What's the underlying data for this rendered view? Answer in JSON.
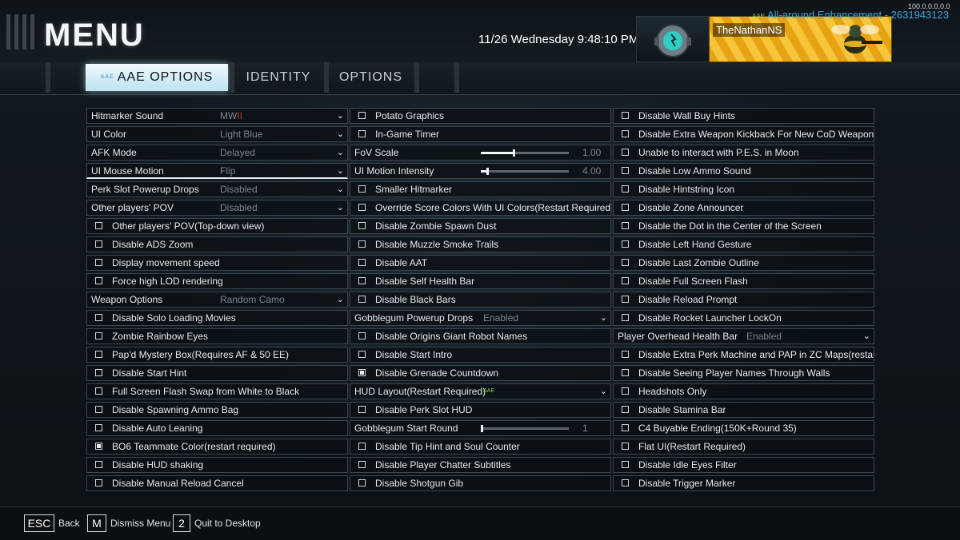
{
  "header": {
    "title": "MENU",
    "datetime": "11/26 Wednesday 9:48:10 PM",
    "version": "100.0.0.0.0.0",
    "mod_tag": "AAE",
    "mod_name": "All-around Enhancement - 2631943123",
    "gamertag": "TheNathanNS"
  },
  "tabs": [
    {
      "label": "AAE OPTIONS",
      "tag": "AAE",
      "active": true
    },
    {
      "label": "IDENTITY",
      "active": false
    },
    {
      "label": "OPTIONS",
      "active": false
    }
  ],
  "columns": [
    {
      "rows": [
        {
          "type": "dropdown",
          "label": "Hitmarker Sound",
          "value": "MW",
          "value_accent": "II"
        },
        {
          "type": "dropdown",
          "label": "UI Color",
          "value": "Light Blue"
        },
        {
          "type": "dropdown",
          "label": "AFK Mode",
          "value": "Delayed"
        },
        {
          "type": "dropdown",
          "label": "UI Mouse Motion",
          "value": "Flip",
          "selected": true
        },
        {
          "type": "dropdown",
          "label": "Perk Slot Powerup Drops",
          "value": "Disabled"
        },
        {
          "type": "dropdown",
          "label": "Other players' POV",
          "value": "Disabled"
        },
        {
          "type": "checkbox",
          "label": "Other players' POV(Top-down view)",
          "checked": false
        },
        {
          "type": "checkbox",
          "label": "Disable ADS Zoom",
          "checked": false
        },
        {
          "type": "checkbox",
          "label": "Display movement speed",
          "checked": false
        },
        {
          "type": "checkbox",
          "label": "Force high LOD rendering",
          "checked": false
        },
        {
          "type": "dropdown",
          "label": "Weapon Options",
          "value": "Random Camo"
        },
        {
          "type": "checkbox",
          "label": "Disable Solo Loading Movies",
          "checked": false
        },
        {
          "type": "checkbox",
          "label": "Zombie Rainbow Eyes",
          "checked": false
        },
        {
          "type": "checkbox",
          "label": "Pap'd Mystery Box(Requires AF & 50 EE)",
          "checked": false
        },
        {
          "type": "checkbox",
          "label": "Disable Start Hint",
          "checked": false
        },
        {
          "type": "checkbox",
          "label": "Full Screen Flash Swap from White to Black",
          "checked": false
        },
        {
          "type": "checkbox",
          "label": "Disable Spawning Ammo Bag",
          "checked": false
        },
        {
          "type": "checkbox",
          "label": "Disable Auto Leaning",
          "checked": false
        },
        {
          "type": "checkbox",
          "label": "BO6 Teammate Color(restart required)",
          "checked": true
        },
        {
          "type": "checkbox",
          "label": "Disable HUD shaking",
          "checked": false
        },
        {
          "type": "checkbox",
          "label": "Disable Manual Reload Cancel",
          "checked": false
        }
      ]
    },
    {
      "rows": [
        {
          "type": "checkbox",
          "label": "Potato Graphics",
          "checked": false
        },
        {
          "type": "checkbox",
          "label": "In-Game Timer",
          "checked": false
        },
        {
          "type": "slider",
          "label": "FoV Scale",
          "value": "1.00",
          "fill": 0.36
        },
        {
          "type": "slider",
          "label": "UI Motion Intensity",
          "value": "4.00",
          "fill": 0.06
        },
        {
          "type": "checkbox",
          "label": "Smaller Hitmarker",
          "checked": false
        },
        {
          "type": "checkbox",
          "label": "Override Score Colors With UI Colors(Restart Required)",
          "checked": false
        },
        {
          "type": "checkbox",
          "label": "Disable Zombie Spawn Dust",
          "checked": false
        },
        {
          "type": "checkbox",
          "label": "Disable Muzzle Smoke Trails",
          "checked": false
        },
        {
          "type": "checkbox",
          "label": "Disable AAT",
          "checked": false
        },
        {
          "type": "checkbox",
          "label": "Disable Self Health Bar",
          "checked": false
        },
        {
          "type": "checkbox",
          "label": "Disable Black Bars",
          "checked": false
        },
        {
          "type": "dropdown",
          "label": "Gobblegum Powerup Drops",
          "value": "Enabled"
        },
        {
          "type": "checkbox",
          "label": "Disable Origins Giant Robot Names",
          "checked": false
        },
        {
          "type": "checkbox",
          "label": "Disable Start Intro",
          "checked": false
        },
        {
          "type": "checkbox",
          "label": "Disable Grenade Countdown",
          "checked": true
        },
        {
          "type": "dropdown",
          "label": "HUD Layout(Restart Required)",
          "value": "AAE",
          "value_is_tag": true
        },
        {
          "type": "checkbox",
          "label": "Disable Perk Slot HUD",
          "checked": false
        },
        {
          "type": "slider",
          "label": "Gobblegum Start Round",
          "value": "1",
          "fill": 0.0
        },
        {
          "type": "checkbox",
          "label": "Disable Tip Hint and Soul Counter",
          "checked": false
        },
        {
          "type": "checkbox",
          "label": "Disable Player Chatter Subtitles",
          "checked": false
        },
        {
          "type": "checkbox",
          "label": "Disable Shotgun Gib",
          "checked": false
        }
      ]
    },
    {
      "rows": [
        {
          "type": "checkbox",
          "label": "Disable Wall Buy Hints",
          "checked": false
        },
        {
          "type": "checkbox",
          "label": "Disable Extra Weapon Kickback For New CoD Weapons",
          "checked": false
        },
        {
          "type": "checkbox",
          "label": "Unable to interact with P.E.S. in Moon",
          "checked": false
        },
        {
          "type": "checkbox",
          "label": "Disable Low Ammo Sound",
          "checked": false
        },
        {
          "type": "checkbox",
          "label": "Disable Hintstring Icon",
          "checked": false
        },
        {
          "type": "checkbox",
          "label": "Disable Zone Announcer",
          "checked": false
        },
        {
          "type": "checkbox",
          "label": "Disable the Dot in the Center of the Screen",
          "checked": false
        },
        {
          "type": "checkbox",
          "label": "Disable Left Hand Gesture",
          "checked": false
        },
        {
          "type": "checkbox",
          "label": "Disable Last Zombie Outline",
          "checked": false
        },
        {
          "type": "checkbox",
          "label": "Disable Full Screen Flash",
          "checked": false
        },
        {
          "type": "checkbox",
          "label": "Disable Reload Prompt",
          "checked": false
        },
        {
          "type": "checkbox",
          "label": "Disable Rocket Launcher LockOn",
          "checked": false
        },
        {
          "type": "dropdown",
          "label": "Player Overhead Health Bar",
          "value": "Enabled"
        },
        {
          "type": "checkbox",
          "label": "Disable Extra Perk Machine and PAP in ZC Maps(restart required)",
          "checked": false
        },
        {
          "type": "checkbox",
          "label": "Disable Seeing Player Names Through Walls",
          "checked": false
        },
        {
          "type": "checkbox",
          "label": "Headshots Only",
          "checked": false
        },
        {
          "type": "checkbox",
          "label": "Disable Stamina Bar",
          "checked": false
        },
        {
          "type": "checkbox",
          "label": "C4 Buyable Ending(150K+Round 35)",
          "checked": false
        },
        {
          "type": "checkbox",
          "label": "Flat UI(Restart Required)",
          "checked": false
        },
        {
          "type": "checkbox",
          "label": "Disable Idle Eyes Filter",
          "checked": false
        },
        {
          "type": "checkbox",
          "label": "Disable Trigger Marker",
          "checked": false
        }
      ]
    }
  ],
  "footer": [
    {
      "key": "ESC",
      "label": "Back"
    },
    {
      "key": "M",
      "label": "Dismiss Menu"
    },
    {
      "key": "2",
      "label": "Quit to Desktop"
    }
  ]
}
